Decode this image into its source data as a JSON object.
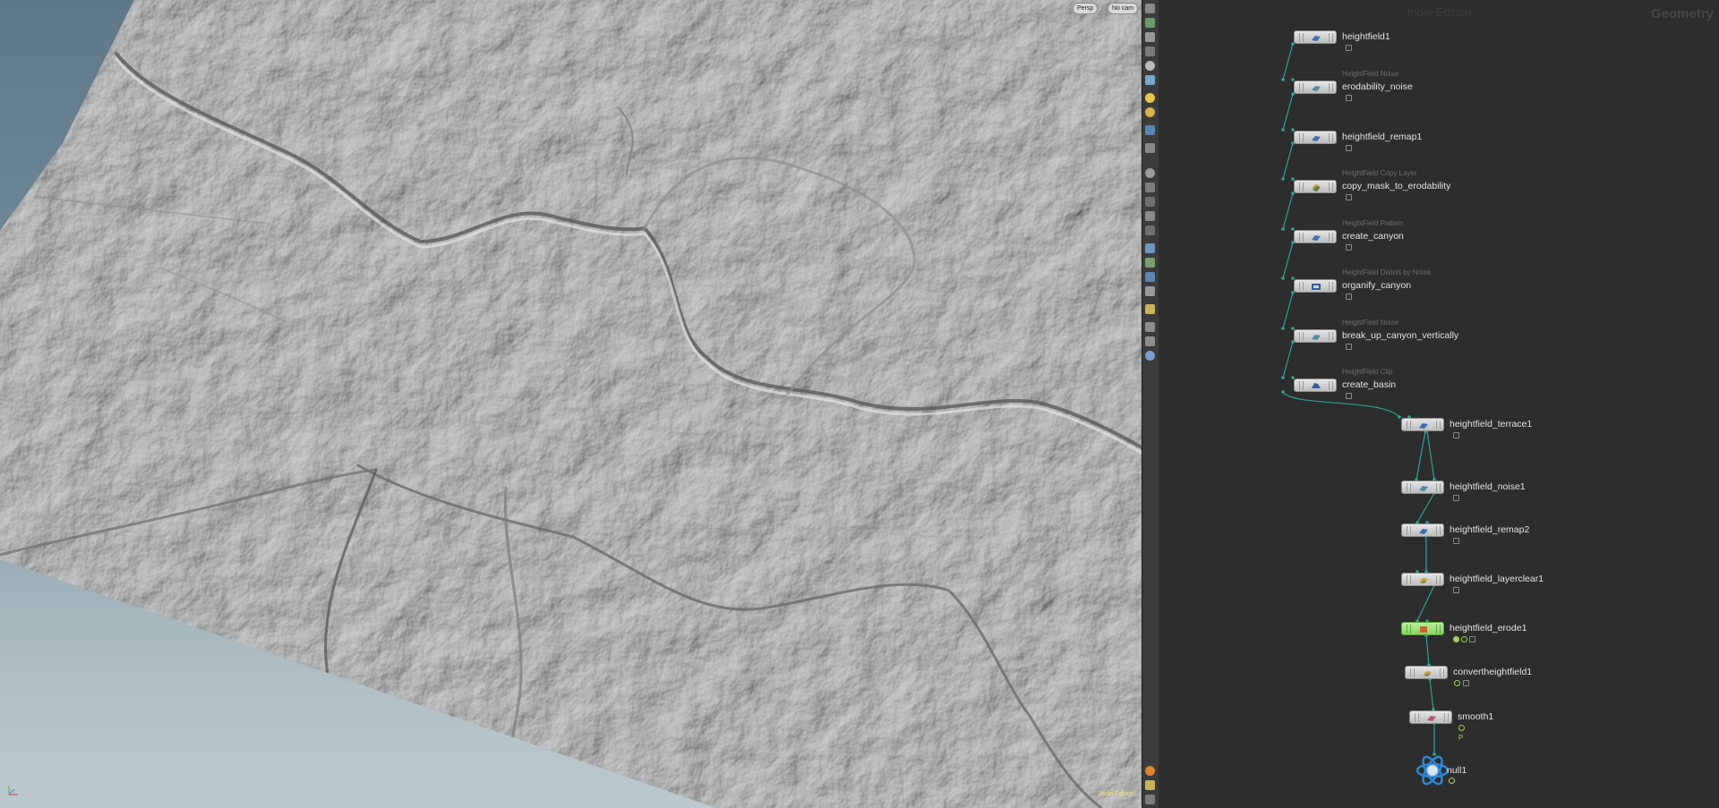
{
  "viewport": {
    "camera_mode": "Persp",
    "camera_name": "No cam",
    "edition_badge": "Indie Edition"
  },
  "network": {
    "watermark": "Indie Edition",
    "context_label": "Geometry",
    "nodes": [
      {
        "name": "heightfield1",
        "type": ""
      },
      {
        "name": "erodability_noise",
        "type": "HeightField Noise"
      },
      {
        "name": "heightfield_remap1",
        "type": ""
      },
      {
        "name": "copy_mask_to_erodability",
        "type": "HeightField Copy Layer"
      },
      {
        "name": "create_canyon",
        "type": "HeightField Pattern"
      },
      {
        "name": "organify_canyon",
        "type": "HeightField Distort by Noise"
      },
      {
        "name": "break_up_canyon_vertically",
        "type": "HeightField Noise"
      },
      {
        "name": "create_basin",
        "type": "HeightField Clip"
      },
      {
        "name": "heightfield_terrace1",
        "type": ""
      },
      {
        "name": "heightfield_noise1",
        "type": ""
      },
      {
        "name": "heightfield_remap2",
        "type": ""
      },
      {
        "name": "heightfield_layerclear1",
        "type": ""
      },
      {
        "name": "heightfield_erode1",
        "type": ""
      },
      {
        "name": "convertheightfield1",
        "type": ""
      },
      {
        "name": "smooth1",
        "type": ""
      },
      {
        "name": "null1",
        "type": ""
      }
    ],
    "smooth_flag": "P",
    "selected_node": "heightfield_erode1"
  },
  "colors": {
    "wire": "#2fa58f",
    "selected_node": "#9ee67a",
    "network_bg": "#2d2d2d"
  },
  "icons": {
    "toolbar": [
      "eye-icon",
      "select-icon",
      "lock-icon",
      "snap-icon",
      "camera-icon",
      "light-icon",
      "point-light-icon",
      "spot-light-icon",
      "handle-icon",
      "brush-icon",
      "view-icon",
      "grid-icon"
    ],
    "gizmo": "axis-gizmo-icon"
  }
}
